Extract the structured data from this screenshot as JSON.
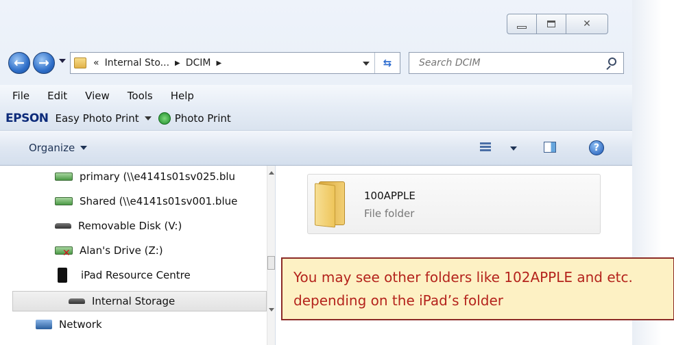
{
  "window": {
    "caption": {
      "minimize": "minimize",
      "maximize": "maximize",
      "close": "close"
    }
  },
  "navigation": {
    "address": {
      "overflow": "«",
      "crumbs": [
        "Internal Sto...",
        "DCIM"
      ]
    },
    "search": {
      "placeholder": "Search DCIM"
    }
  },
  "menubar": {
    "items": [
      "File",
      "Edit",
      "View",
      "Tools",
      "Help"
    ]
  },
  "epson_toolbar": {
    "logo": "EPSON",
    "easy_photo_print": "Easy Photo Print",
    "photo_print": "Photo Print"
  },
  "command_bar": {
    "organize": "Organize"
  },
  "nav_pane": {
    "items": [
      {
        "label": "primary (\\\\e4141s01sv025.blu",
        "icon": "network-drive-icon"
      },
      {
        "label": "Shared (\\\\e4141s01sv001.blue",
        "icon": "network-drive-icon"
      },
      {
        "label": "Removable Disk (V:)",
        "icon": "removable-disk-icon"
      },
      {
        "label": "Alan's Drive (Z:)",
        "icon": "disconnected-drive-icon"
      },
      {
        "label": "iPad Resource Centre",
        "icon": "ipad-icon"
      },
      {
        "label": "Internal Storage",
        "icon": "storage-icon",
        "selected": true
      },
      {
        "label": "Network",
        "icon": "network-icon"
      }
    ]
  },
  "content": {
    "folders": [
      {
        "name": "100APPLE",
        "type": "File folder"
      }
    ]
  },
  "callout": {
    "text": "You may see other folders like 102APPLE and etc. depending on the iPad’s folder"
  },
  "colors": {
    "callout_background": "#fdf1c4",
    "callout_border": "#8b2a26",
    "callout_text": "#b4231c",
    "epson_logo": "#0d2b7a"
  }
}
